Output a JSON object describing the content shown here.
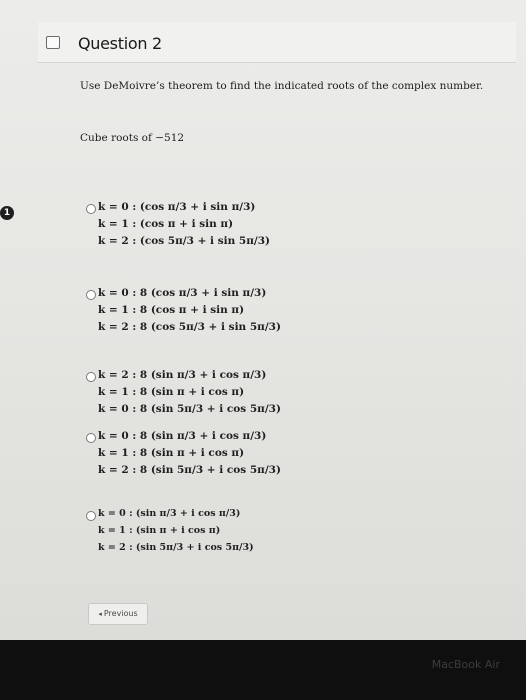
{
  "question": {
    "title": "Question 2",
    "instruction": "Use DeMoivre’s theorem to find the indicated roots of the complex number.",
    "prompt": "Cube roots of −512"
  },
  "options": [
    {
      "lines": [
        "k = 0 : (cos π/3 + i sin π/3)",
        "k = 1 : (cos π + i sin π)",
        "k = 2 : (cos 5π/3 + i sin 5π/3)"
      ]
    },
    {
      "lines": [
        "k = 0 : 8 (cos π/3 + i sin π/3)",
        "k = 1 : 8 (cos π + i sin π)",
        "k = 2 : 8 (cos 5π/3 + i sin 5π/3)"
      ]
    },
    {
      "lines": [
        "k = 2 : 8 (sin π/3 + i cos π/3)",
        "k = 1 : 8 (sin π + i cos π)",
        "k = 0 : 8 (sin 5π/3 + i cos 5π/3)"
      ]
    },
    {
      "lines": [
        "k = 0 : 8 (sin π/3 + i cos π/3)",
        "k = 1 : 8 (sin π + i cos π)",
        "k = 2 : 8 (sin 5π/3 + i cos 5π/3)"
      ]
    },
    {
      "lines": [
        "k = 0 : (sin π/3 + i cos π/3)",
        "k = 1 : (sin π + i cos π)",
        "k = 2 : (sin 5π/3 + i cos 5π/3)"
      ]
    }
  ],
  "nav": {
    "previous_label": "Previous",
    "previous_icon": "triangle-left-icon"
  },
  "badge_text": "1",
  "device_brand": "MacBook Air"
}
